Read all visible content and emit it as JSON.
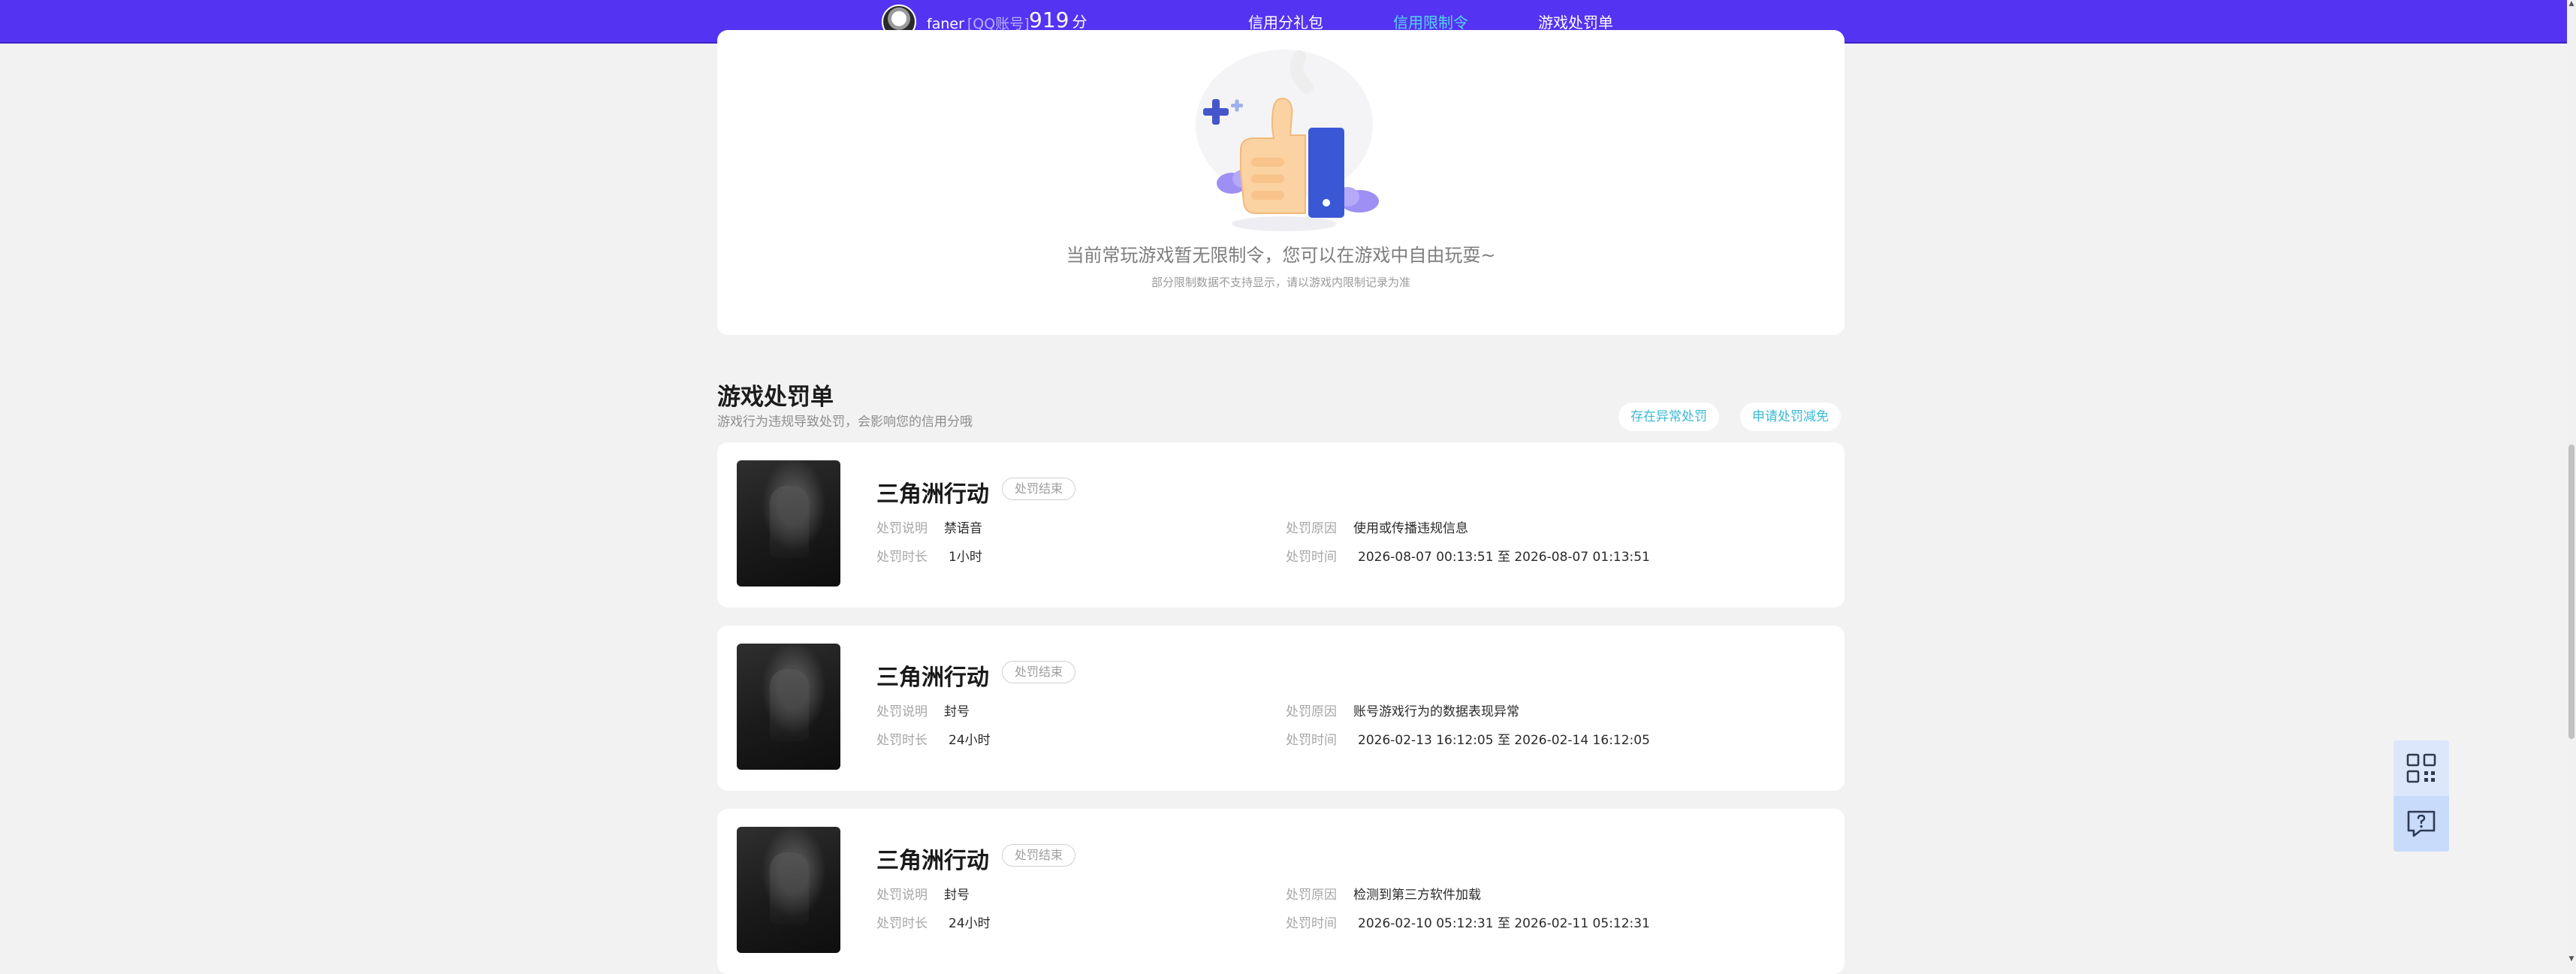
{
  "topbar": {
    "username": "faner",
    "account_type": "[QQ账号]",
    "score": "919",
    "score_unit": "分",
    "tabs": [
      {
        "label": "信用分礼包",
        "active": false
      },
      {
        "label": "信用限制令",
        "active": true
      },
      {
        "label": "游戏处罚单",
        "active": false
      }
    ]
  },
  "restriction": {
    "empty_title": "当前常玩游戏暂无限制令，您可以在游戏中自由玩耍~",
    "empty_subtitle": "部分限制数据不支持显示，请以游戏内限制记录为准"
  },
  "penalty_section": {
    "title": "游戏处罚单",
    "description": "游戏行为违规导致处罚，会影响您的信用分哦",
    "btn_abnormal": "存在异常处罚",
    "btn_reduce": "申请处罚减免",
    "labels": {
      "desc": "处罚说明",
      "duration": "处罚时长",
      "reason": "处罚原因",
      "time": "处罚时间"
    },
    "items": [
      {
        "game": "三角洲行动",
        "status": "处罚结束",
        "desc": "禁语音",
        "duration": "1小时",
        "reason": "使用或传播违规信息",
        "time": "2026-08-07 00:13:51 至 2026-08-07 01:13:51"
      },
      {
        "game": "三角洲行动",
        "status": "处罚结束",
        "desc": "封号",
        "duration": "24小时",
        "reason": "账号游戏行为的数据表现异常",
        "time": "2026-02-13 16:12:05 至 2026-02-14 16:12:05"
      },
      {
        "game": "三角洲行动",
        "status": "处罚结束",
        "desc": "封号",
        "duration": "24小时",
        "reason": "检测到第三方软件加载",
        "time": "2026-02-10 05:12:31 至 2026-02-11 05:12:31"
      }
    ]
  },
  "floating_tools": {
    "qr_icon": "qrcode-icon",
    "help_icon": "chat-question-icon"
  },
  "colors": {
    "brand": "#5433f2",
    "accent": "#55d6ef",
    "link": "#3bb9d6",
    "background": "#f2f2f2"
  }
}
